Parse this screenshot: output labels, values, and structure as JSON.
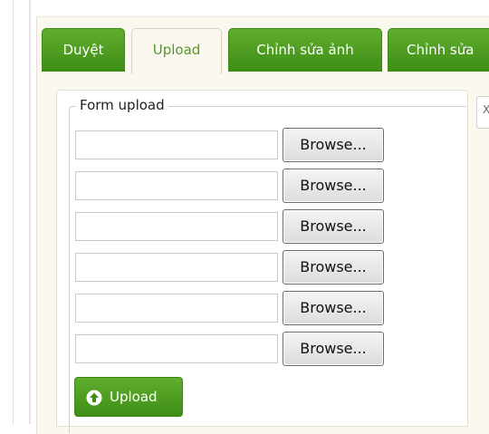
{
  "tabs": [
    {
      "label": "Duyệt",
      "active": false
    },
    {
      "label": "Upload",
      "active": true
    },
    {
      "label": "Chỉnh sửa ảnh",
      "active": false
    },
    {
      "label": "Chỉnh sửa",
      "active": false
    }
  ],
  "form": {
    "legend": "Form upload",
    "file_rows": [
      {
        "value": "",
        "browse_label": "Browse..."
      },
      {
        "value": "",
        "browse_label": "Browse..."
      },
      {
        "value": "",
        "browse_label": "Browse..."
      },
      {
        "value": "",
        "browse_label": "Browse..."
      },
      {
        "value": "",
        "browse_label": "Browse..."
      },
      {
        "value": "",
        "browse_label": "Browse..."
      }
    ],
    "upload_label": "Upload"
  },
  "side_tab": {
    "glyph": "X"
  },
  "colors": {
    "accent_green": "#4a9c1e",
    "panel_bg": "#fbf8ef"
  },
  "icons": {
    "upload": "circle-arrow-up-icon"
  }
}
